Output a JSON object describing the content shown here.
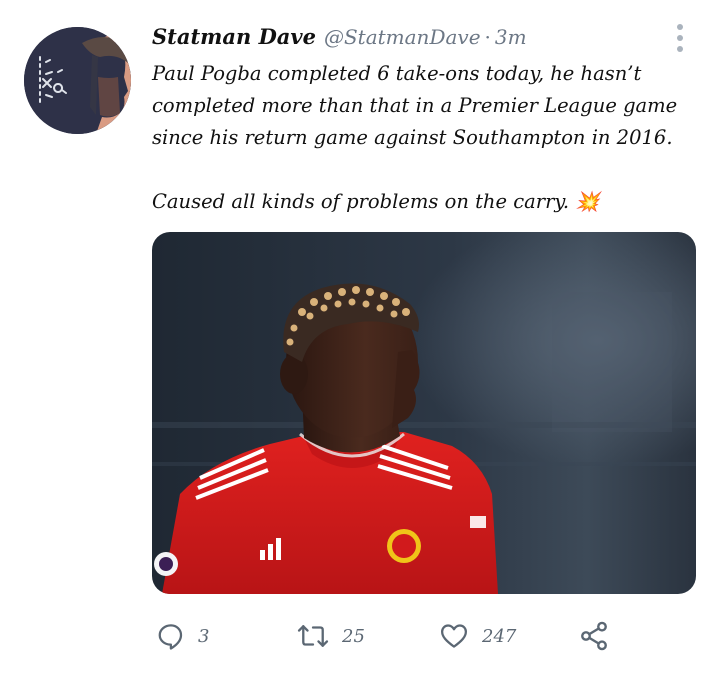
{
  "tweet": {
    "author_name": "Statman Dave",
    "author_handle": "@StatmanDave",
    "separator": "·",
    "time": "3m",
    "text_line1": "Paul Pogba completed 6 take-ons today, he hasn’t completed more than that in a Premier League game since his return game against Southampton in 2016.",
    "text_line2": "Caused all kinds of problems on the carry. 💥"
  },
  "actions": {
    "reply_count": "3",
    "retweet_count": "25",
    "like_count": "247"
  },
  "icons": {
    "more": "more-vertical-icon",
    "reply": "reply-icon",
    "retweet": "retweet-icon",
    "like": "heart-icon",
    "share": "share-icon"
  },
  "colors": {
    "icon_gray": "#5b6773",
    "shirt_red": "#d7191c",
    "background_dark": "#27303c"
  }
}
